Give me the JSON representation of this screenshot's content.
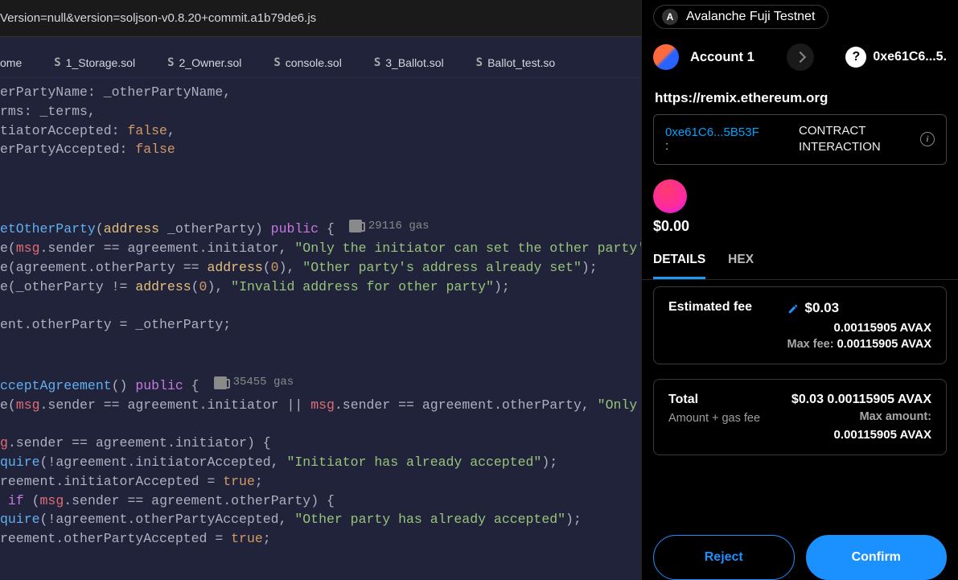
{
  "url_bar": "Version=null&version=soljson-v0.8.20+commit.a1b79de6.js",
  "tabs": [
    {
      "label": "ome"
    },
    {
      "label": "1_Storage.sol"
    },
    {
      "label": "2_Owner.sol"
    },
    {
      "label": "console.sol"
    },
    {
      "label": "3_Ballot.sol"
    },
    {
      "label": "Ballot_test.so"
    }
  ],
  "code": {
    "l0": "erPartyName: _otherPartyName,",
    "l1": "rms: _terms,",
    "l2a": "tiatorAccepted: ",
    "l2b": "false",
    "l2c": ",",
    "l3a": "erPartyAccepted: ",
    "l3b": "false",
    "sigA_a": "etOtherParty",
    "sigA_b": "(",
    "sigA_c": "address",
    "sigA_d": " _otherParty) ",
    "sigA_e": "public",
    "sigA_f": " {",
    "gasA": "29116 gas",
    "r1a": "e(",
    "r1b": "msg",
    "r1c": ".sender == agreement.initiator, ",
    "r1d": "\"Only the initiator can set the other party's a",
    "r2a": "e(agreement.otherParty == ",
    "r2b": "address",
    "r2c": "(",
    "r2d": "0",
    "r2e": "), ",
    "r2f": "\"Other party's address already set\"",
    "r2g": ");",
    "r3a": "e(_otherParty != ",
    "r3b": "address",
    "r3c": "(",
    "r3d": "0",
    "r3e": "), ",
    "r3f": "\"Invalid address for other party\"",
    "r3g": ");",
    "r4": "ent.otherParty = _otherParty;",
    "sigB_a": "cceptAgreement",
    "sigB_b": "() ",
    "sigB_c": "public",
    "sigB_d": " {",
    "gasB": "35455 gas",
    "r5a": "e(",
    "r5b": "msg",
    "r5c": ".sender == agreement.initiator || ",
    "r5d": "msg",
    "r5e": ".sender == agreement.otherParty, ",
    "r5f": "\"Only the",
    "r6a": "g",
    "r6b": ".sender == agreement.initiator) {",
    "r7a": "quire",
    "r7b": "(!agreement.initiatorAccepted, ",
    "r7c": "\"Initiator has already accepted\"",
    "r7d": ");",
    "r8a": "reement.initiatorAccepted = ",
    "r8b": "true",
    "r8c": ";",
    "r9a": " if",
    "r9b": " (",
    "r9c": "msg",
    "r9d": ".sender == agreement.otherParty) {",
    "r10a": "quire",
    "r10b": "(!agreement.otherPartyAccepted, ",
    "r10c": "\"Other party has already accepted\"",
    "r10d": ");",
    "r11a": "reement.otherPartyAccepted = ",
    "r11b": "true",
    "r11c": ";"
  },
  "wallet": {
    "network_letter": "A",
    "network": "Avalanche Fuji Testnet",
    "account": "Account 1",
    "header_addr": "0xe61C6...5.",
    "origin": "https://remix.ethereum.org",
    "tx_addr": "0xe61C6...5B53F",
    "tx_colon": ":",
    "tx_type_l1": "CONTRACT",
    "tx_type_l2": "INTERACTION",
    "balance": "$0.00",
    "tabs": {
      "details": "DETAILS",
      "hex": "HEX"
    },
    "fee": {
      "title": "Estimated fee",
      "usd": "$0.03",
      "native": "0.00115905 AVAX",
      "max_label": "Max fee:",
      "max_val": "0.00115905 AVAX"
    },
    "total": {
      "title": "Total",
      "sub": "Amount + gas fee",
      "usd": "$0.03",
      "native": "0.00115905 AVAX",
      "maxamt_label": "Max amount:",
      "maxamt_val": "0.00115905 AVAX"
    },
    "buttons": {
      "reject": "Reject",
      "confirm": "Confirm"
    }
  }
}
